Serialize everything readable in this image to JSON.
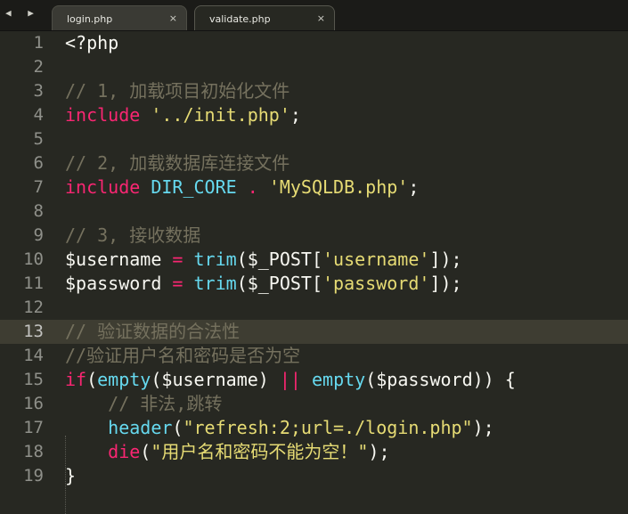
{
  "tabs": [
    {
      "label": "login.php",
      "close": "×",
      "active": false
    },
    {
      "label": "validate.php",
      "close": "×",
      "active": true
    }
  ],
  "nav": {
    "arrows": "◀ ▶"
  },
  "current_line": 13,
  "lines": [
    {
      "n": "1",
      "t": [
        {
          "c": "pl",
          "s": "<?php"
        }
      ]
    },
    {
      "n": "2",
      "t": []
    },
    {
      "n": "3",
      "t": [
        {
          "c": "cm",
          "s": "// 1, 加载项目初始化文件"
        }
      ]
    },
    {
      "n": "4",
      "t": [
        {
          "c": "kw",
          "s": "include"
        },
        {
          "c": "pl",
          "s": " "
        },
        {
          "c": "str",
          "s": "'../init.php'"
        },
        {
          "c": "pl",
          "s": ";"
        }
      ]
    },
    {
      "n": "5",
      "t": []
    },
    {
      "n": "6",
      "t": [
        {
          "c": "cm",
          "s": "// 2, 加载数据库连接文件"
        }
      ]
    },
    {
      "n": "7",
      "t": [
        {
          "c": "kw",
          "s": "include"
        },
        {
          "c": "pl",
          "s": " "
        },
        {
          "c": "fn",
          "s": "DIR_CORE"
        },
        {
          "c": "pl",
          "s": " "
        },
        {
          "c": "kw",
          "s": "."
        },
        {
          "c": "pl",
          "s": " "
        },
        {
          "c": "str",
          "s": "'MySQLDB.php'"
        },
        {
          "c": "pl",
          "s": ";"
        }
      ]
    },
    {
      "n": "8",
      "t": []
    },
    {
      "n": "9",
      "t": [
        {
          "c": "cm",
          "s": "// 3, 接收数据"
        }
      ]
    },
    {
      "n": "10",
      "t": [
        {
          "c": "pl",
          "s": "$username "
        },
        {
          "c": "kw",
          "s": "="
        },
        {
          "c": "pl",
          "s": " "
        },
        {
          "c": "fn",
          "s": "trim"
        },
        {
          "c": "pl",
          "s": "($_POST["
        },
        {
          "c": "str",
          "s": "'username'"
        },
        {
          "c": "pl",
          "s": "]);"
        }
      ]
    },
    {
      "n": "11",
      "t": [
        {
          "c": "pl",
          "s": "$password "
        },
        {
          "c": "kw",
          "s": "="
        },
        {
          "c": "pl",
          "s": " "
        },
        {
          "c": "fn",
          "s": "trim"
        },
        {
          "c": "pl",
          "s": "($_POST["
        },
        {
          "c": "str",
          "s": "'password'"
        },
        {
          "c": "pl",
          "s": "]);"
        }
      ]
    },
    {
      "n": "12",
      "t": []
    },
    {
      "n": "13",
      "t": [
        {
          "c": "cm",
          "s": "// 验证数据的合法性"
        }
      ]
    },
    {
      "n": "14",
      "t": [
        {
          "c": "cm",
          "s": "//验证用户名和密码是否为空"
        }
      ]
    },
    {
      "n": "15",
      "t": [
        {
          "c": "kw",
          "s": "if"
        },
        {
          "c": "pl",
          "s": "("
        },
        {
          "c": "fn",
          "s": "empty"
        },
        {
          "c": "pl",
          "s": "($username) "
        },
        {
          "c": "kw",
          "s": "||"
        },
        {
          "c": "pl",
          "s": " "
        },
        {
          "c": "fn",
          "s": "empty"
        },
        {
          "c": "pl",
          "s": "($password)) {"
        }
      ]
    },
    {
      "n": "16",
      "t": [
        {
          "c": "pl",
          "s": "    "
        },
        {
          "c": "cm",
          "s": "// 非法,跳转"
        }
      ]
    },
    {
      "n": "17",
      "t": [
        {
          "c": "pl",
          "s": "    "
        },
        {
          "c": "fn",
          "s": "header"
        },
        {
          "c": "pl",
          "s": "("
        },
        {
          "c": "str",
          "s": "\"refresh:2;url=./login.php\""
        },
        {
          "c": "pl",
          "s": ");"
        }
      ]
    },
    {
      "n": "18",
      "t": [
        {
          "c": "pl",
          "s": "    "
        },
        {
          "c": "kw",
          "s": "die"
        },
        {
          "c": "pl",
          "s": "("
        },
        {
          "c": "str",
          "s": "\"用户名和密码不能为空！\""
        },
        {
          "c": "pl",
          "s": ");"
        }
      ]
    },
    {
      "n": "19",
      "t": [
        {
          "c": "pl",
          "s": "}"
        }
      ]
    }
  ],
  "colors": {
    "background": "#272822",
    "keyword": "#f92672",
    "string": "#e6db74",
    "function": "#66d9ef",
    "comment": "#75715e",
    "plain": "#f8f8f2"
  }
}
